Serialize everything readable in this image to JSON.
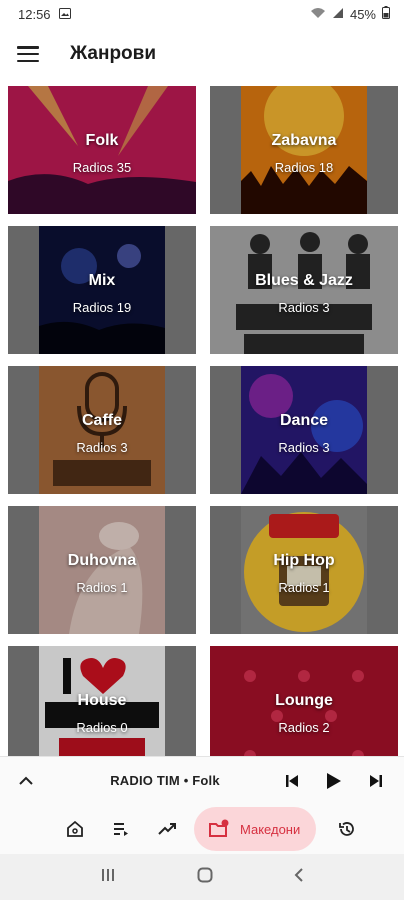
{
  "status_bar": {
    "time": "12:56",
    "battery": "45%"
  },
  "app_bar": {
    "title": "Жанрови"
  },
  "genres": [
    {
      "name": "Folk",
      "count": "Radios 35"
    },
    {
      "name": "Zabavna",
      "count": "Radios 18"
    },
    {
      "name": "Mix",
      "count": "Radios 19"
    },
    {
      "name": "Blues & Jazz",
      "count": "Radios 3"
    },
    {
      "name": "Caffe",
      "count": "Radios 3"
    },
    {
      "name": "Dance",
      "count": "Radios 3"
    },
    {
      "name": "Duhovna",
      "count": "Radios 1"
    },
    {
      "name": "Hip Hop",
      "count": "Radios 1"
    },
    {
      "name": "House",
      "count": "Radios 0"
    },
    {
      "name": "Lounge",
      "count": "Radios 2"
    }
  ],
  "player": {
    "now_playing": "RADIO TIM • Folk"
  },
  "bottom_nav": {
    "active_label": "Македони"
  },
  "colors": {
    "accent": "#d63040",
    "accent_bg": "#fbd6d9",
    "card_bg": "#7e7e7e"
  }
}
